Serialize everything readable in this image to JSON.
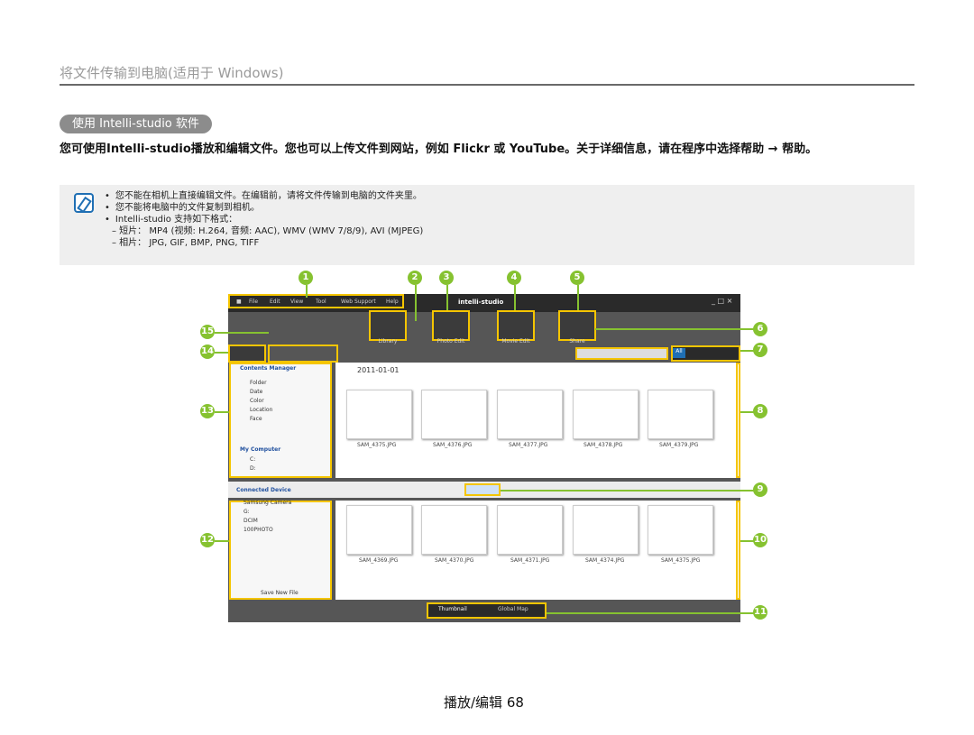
{
  "page": {
    "section_title": "将文件传输到电脑(适用于 Windows)",
    "subheading": "使用 Intelli-studio 软件",
    "intro": "您可使用Intelli-studio播放和编辑文件。您也可以上传文件到网站，例如 Flickr 或 YouTube。关于详细信息，请在程序中选择帮助 → 帮助。",
    "note": {
      "lines": [
        "您不能在相机上直接编辑文件。在编辑前，请将文件传输到电脑的文件夹里。",
        "您不能将电脑中的文件复制到相机。",
        "Intelli-studio 支持如下格式："
      ],
      "formats": [
        "– 短片： MP4 (视频: H.264, 音频: AAC), WMV (WMV 7/8/9), AVI (MJPEG)",
        "– 相片： JPG, GIF, BMP, PNG, TIFF"
      ]
    },
    "footer": "播放/编辑 68"
  },
  "callouts": [
    "1",
    "2",
    "3",
    "4",
    "5",
    "6",
    "7",
    "8",
    "9",
    "10",
    "11",
    "12",
    "13",
    "14",
    "15"
  ],
  "app": {
    "menu": [
      "File",
      "Edit",
      "View",
      "Tool",
      "Web Support",
      "Help"
    ],
    "logo": "intelli-studio",
    "toolbar": [
      "Library",
      "Photo Edit",
      "Movie Edit",
      "Share"
    ],
    "view_filters": [
      "All"
    ],
    "left_panel": {
      "header": "Contents Manager",
      "items": [
        "Folder",
        "Date",
        "Color",
        "Location",
        "Face"
      ],
      "computer_header": "My Computer",
      "drives": [
        "C:",
        "D:"
      ]
    },
    "date_header": "2011-01-01",
    "top_thumbs": [
      "SAM_4375.JPG",
      "SAM_4376.JPG",
      "SAM_4377.JPG",
      "SAM_4378.JPG",
      "SAM_4379.JPG"
    ],
    "device_bar": "Connected Device",
    "device_tree": [
      "Samsung Camera",
      "G:",
      "DCIM",
      "100PHOTO"
    ],
    "save_button": "Save New File",
    "bottom_thumbs": [
      "SAM_4369.JPG",
      "SAM_4370.JPG",
      "SAM_4371.JPG",
      "SAM_4374.JPG",
      "SAM_4375.JPG"
    ],
    "view_tabs": [
      "Thumbnail",
      "Global Map"
    ]
  }
}
